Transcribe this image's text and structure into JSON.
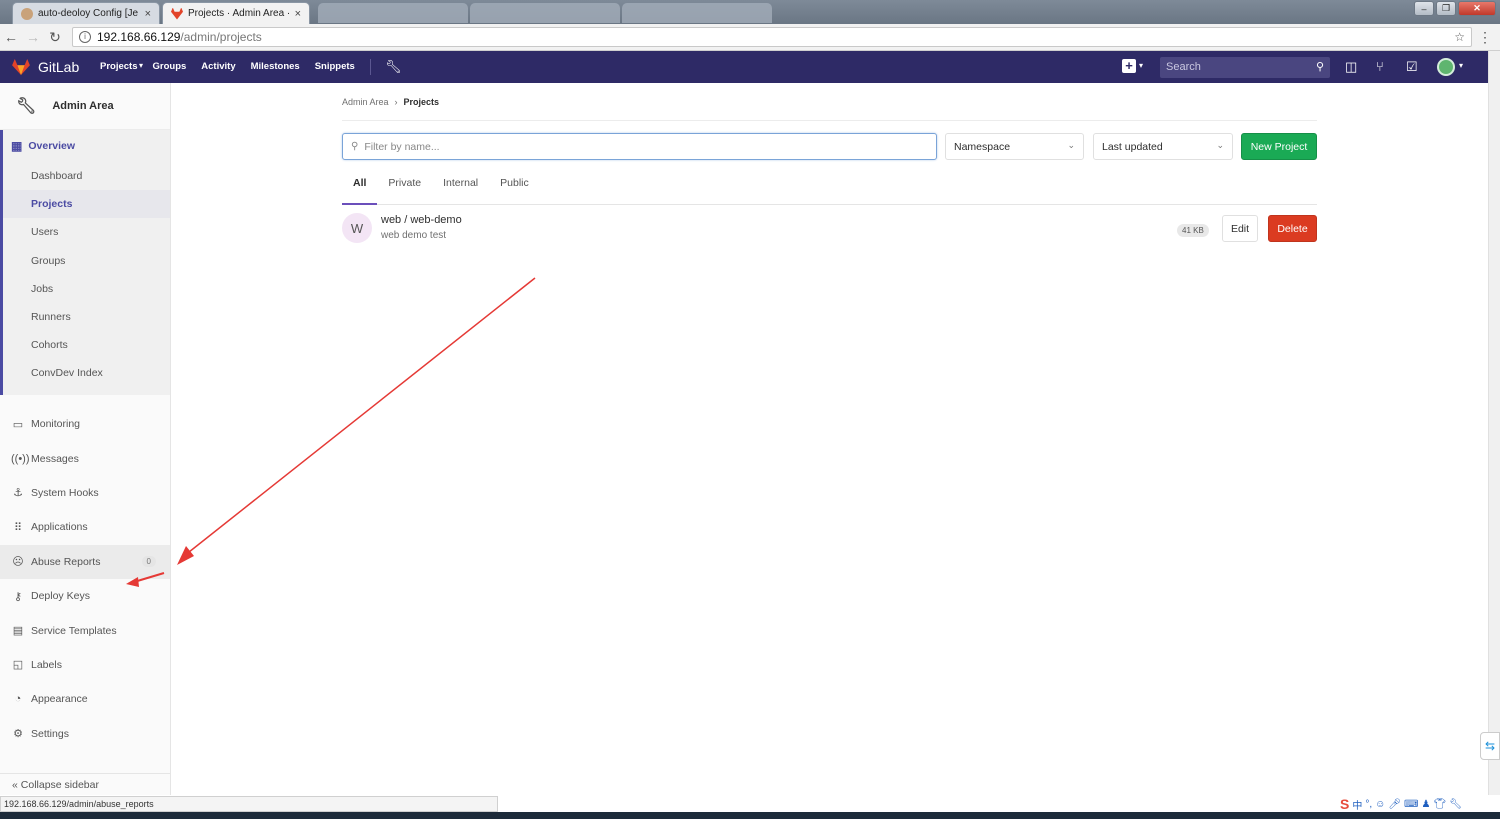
{
  "browser": {
    "tabs": [
      {
        "label": "auto-deoloy Config [Je",
        "close": "×"
      },
      {
        "label": "Projects · Admin Area ·",
        "close": "×"
      }
    ],
    "url_host": "192.168.66.129",
    "url_path": "/admin/projects",
    "status_url": "192.168.66.129/admin/abuse_reports"
  },
  "header": {
    "brand": "GitLab",
    "nav": [
      "Projects",
      "Groups",
      "Activity",
      "Milestones",
      "Snippets"
    ],
    "search_placeholder": "Search"
  },
  "sidebar": {
    "title": "Admin Area",
    "overview": {
      "label": "Overview",
      "items": [
        "Dashboard",
        "Projects",
        "Users",
        "Groups",
        "Jobs",
        "Runners",
        "Cohorts",
        "ConvDev Index"
      ],
      "active": "Projects"
    },
    "items": [
      {
        "label": "Monitoring",
        "icon": "monitor-icon"
      },
      {
        "label": "Messages",
        "icon": "broadcast-icon"
      },
      {
        "label": "System Hooks",
        "icon": "hook-icon"
      },
      {
        "label": "Applications",
        "icon": "grid-icon"
      },
      {
        "label": "Abuse Reports",
        "icon": "abuse-icon",
        "badge": "0"
      },
      {
        "label": "Deploy Keys",
        "icon": "key-icon"
      },
      {
        "label": "Service Templates",
        "icon": "template-icon"
      },
      {
        "label": "Labels",
        "icon": "label-icon"
      },
      {
        "label": "Appearance",
        "icon": "palette-icon"
      },
      {
        "label": "Settings",
        "icon": "gear-icon"
      }
    ],
    "collapse": "Collapse sidebar"
  },
  "main": {
    "breadcrumb": [
      "Admin Area",
      "Projects"
    ],
    "filter_placeholder": "Filter by name...",
    "namespace_label": "Namespace",
    "sort_label": "Last updated",
    "new_project": "New Project",
    "tabs": [
      "All",
      "Private",
      "Internal",
      "Public"
    ],
    "active_tab": "All",
    "projects": [
      {
        "avatar": "W",
        "name": "web / web-demo",
        "description": "web demo test",
        "size": "41 KB",
        "edit": "Edit",
        "delete": "Delete"
      }
    ]
  },
  "colors": {
    "header_bg": "#2e2a66",
    "accent": "#4b4ba3",
    "new_button": "#1aaa55",
    "delete_button": "#db3b21",
    "annotation_arrow": "#e53935"
  }
}
